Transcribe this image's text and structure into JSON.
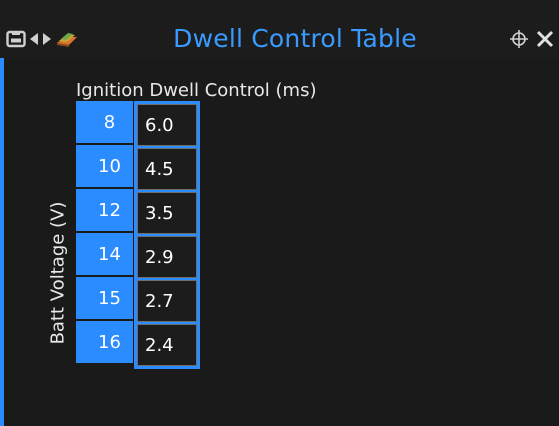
{
  "window": {
    "title": "Dwell Control Table",
    "accent_color": "#2a8cff",
    "title_color": "#3a9bff",
    "background": "#1a1a1a"
  },
  "toolbar_icons": [
    "save-icon",
    "arrow-left-icon",
    "arrow-right-icon",
    "3d-view-icon"
  ],
  "titlebar_right_icons": [
    "move-icon",
    "close-icon"
  ],
  "table": {
    "title": "Ignition Dwell Control (ms)",
    "axis_label": "Batt Voltage (V)",
    "rows": [
      {
        "voltage": "8",
        "dwell": "6.0"
      },
      {
        "voltage": "10",
        "dwell": "4.5"
      },
      {
        "voltage": "12",
        "dwell": "3.5"
      },
      {
        "voltage": "14",
        "dwell": "2.9"
      },
      {
        "voltage": "15",
        "dwell": "2.7"
      },
      {
        "voltage": "16",
        "dwell": "2.4"
      }
    ]
  }
}
